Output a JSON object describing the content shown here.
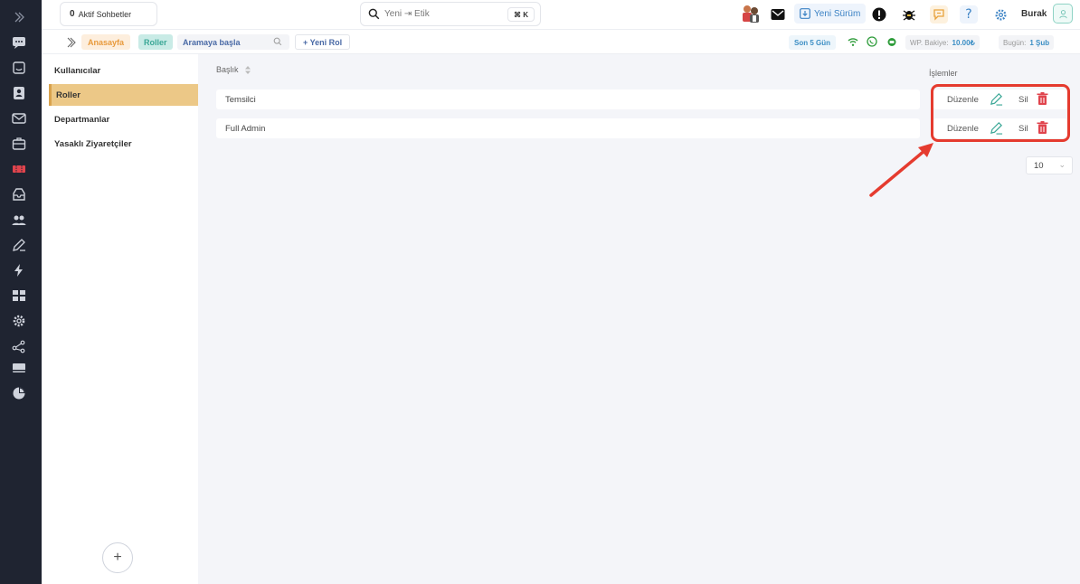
{
  "topbar": {
    "active_chats_count": "0",
    "active_chats_label": "Aktif Sohbetler",
    "search_placeholder": "Yeni ⇥ Etik",
    "search_shortcut": "⌘ K",
    "new_version_label": "Yeni Sürüm",
    "user_name": "Burak"
  },
  "subbar": {
    "breadcrumb_home": "Anasayfa",
    "breadcrumb_current": "Roller",
    "search_placeholder": "Aramaya başla",
    "new_role_label": "+ Yeni Rol",
    "period_label": "Son 5 Gün",
    "wp_balance_label": "WP. Bakiye:",
    "wp_balance_value": "10.00₺",
    "today_label": "Bugün:",
    "today_value": "1 Şub"
  },
  "settings_menu": {
    "items": [
      {
        "label": "Kullanıcılar",
        "active": false
      },
      {
        "label": "Roller",
        "active": true
      },
      {
        "label": "Departmanlar",
        "active": false
      },
      {
        "label": "Yasaklı Ziyaretçiler",
        "active": false
      }
    ],
    "add_symbol": "+"
  },
  "table": {
    "col_title": "Başlık",
    "col_actions": "İşlemler",
    "rows": [
      {
        "title": "Temsilci",
        "edit_label": "Düzenle",
        "delete_label": "Sil"
      },
      {
        "title": "Full Admin",
        "edit_label": "Düzenle",
        "delete_label": "Sil"
      }
    ],
    "page_size": "10"
  },
  "colors": {
    "rail_bg": "#1f2431",
    "active_menu": "#ecc887",
    "highlight": "#e53b2f",
    "edit_icon": "#3aa796",
    "delete_icon": "#e0444d"
  },
  "rail_icons": [
    "expand-icon",
    "chat-icon",
    "conversations-icon",
    "contacts-icon",
    "mail-icon",
    "briefcase-icon",
    "ticket-icon",
    "inbox-icon",
    "users-icon",
    "edit-icon",
    "flash-icon",
    "grid-icon",
    "settings-icon",
    "share-icon",
    "card-icon",
    "pie-chart-icon"
  ]
}
